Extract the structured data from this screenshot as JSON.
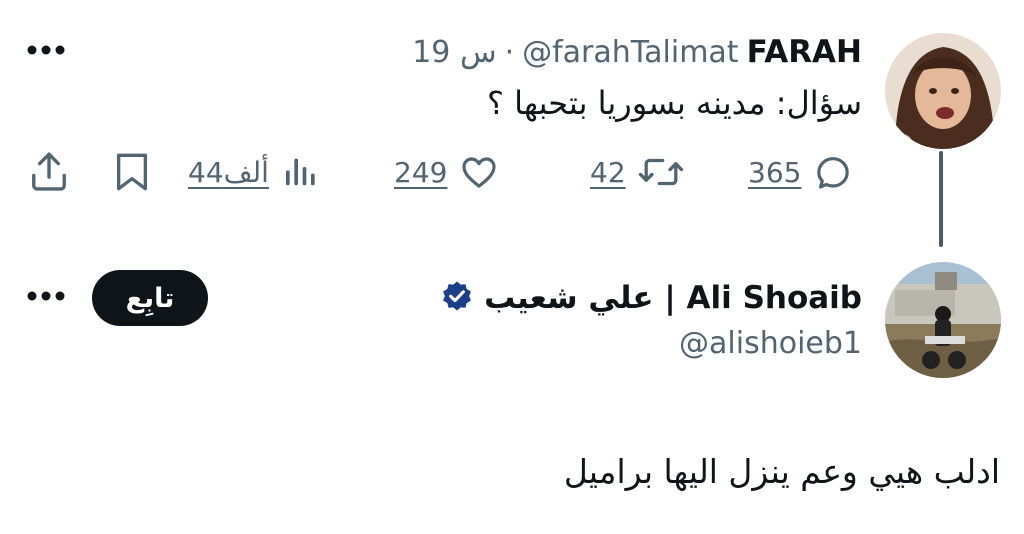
{
  "tweet": {
    "author_name": "FARAH",
    "author_handle": "@farahTalimat",
    "separator": "·",
    "time": "19 س",
    "text": "سؤال: مدينه بسوريا بتحبها ؟",
    "actions": {
      "replies": "365",
      "retweets": "42",
      "likes": "249",
      "views": "44ألف"
    },
    "icons": {
      "more": "more-horizontal-icon",
      "reply": "reply-icon",
      "retweet": "retweet-icon",
      "like": "heart-icon",
      "views": "views-chart-icon",
      "bookmark": "bookmark-icon",
      "share": "share-icon"
    }
  },
  "reply": {
    "author_name": "علي شعيب | Ali Shoaib",
    "author_handle": "@alishoieb1",
    "verified": true,
    "follow_label": "تابِع",
    "text": "ادلب هيي وعم ينزل اليها براميل"
  },
  "colors": {
    "text_primary": "#0f1419",
    "text_secondary": "#536471",
    "verified_badge": "#1d3f8a",
    "follow_button_bg": "#0f1419",
    "thread_line": "#4f5a63"
  }
}
